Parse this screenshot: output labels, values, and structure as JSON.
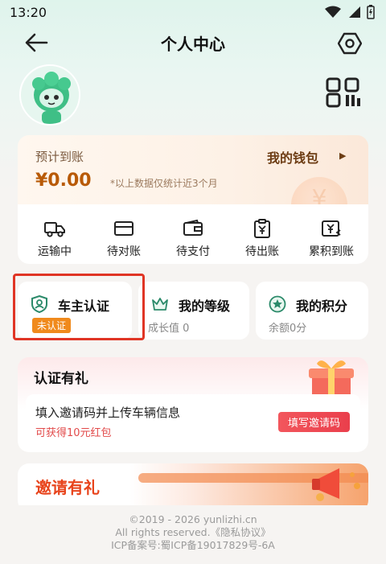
{
  "status_bar": {
    "time": "13:20"
  },
  "header": {
    "title": "个人中心"
  },
  "wallet": {
    "label": "预计到账",
    "link": "我的钱包",
    "amount": "¥0.00",
    "note": "*以上数据仅统计近3个月"
  },
  "orders": [
    {
      "label": "运输中",
      "icon": "truck-icon"
    },
    {
      "label": "待对账",
      "icon": "card-icon"
    },
    {
      "label": "待支付",
      "icon": "wallet-icon"
    },
    {
      "label": "待出账",
      "icon": "clipboard-icon"
    },
    {
      "label": "累积到账",
      "icon": "yen-receipt-icon"
    }
  ],
  "tiles": {
    "owner_cert": {
      "title": "车主认证",
      "badge": "未认证"
    },
    "level": {
      "title": "我的等级",
      "sub": "成长值 0"
    },
    "points": {
      "title": "我的积分",
      "sub": "余额0分"
    }
  },
  "cert_card": {
    "title": "认证有礼",
    "desc": "填入邀请码并上传车辆信息",
    "reward": "可获得10元红包",
    "button": "填写邀请码"
  },
  "invite_card": {
    "title": "邀请有礼"
  },
  "footer": {
    "line1": "©2019 - 2026 yunlizhi.cn",
    "line2": "All rights reserved.《隐私协议》",
    "line3": "ICP备案号:蜀ICP备19017829号-6A"
  },
  "colors": {
    "accent_orange": "#f08a1c",
    "highlight_red": "#e03525",
    "wallet_amount": "#b85a07"
  }
}
